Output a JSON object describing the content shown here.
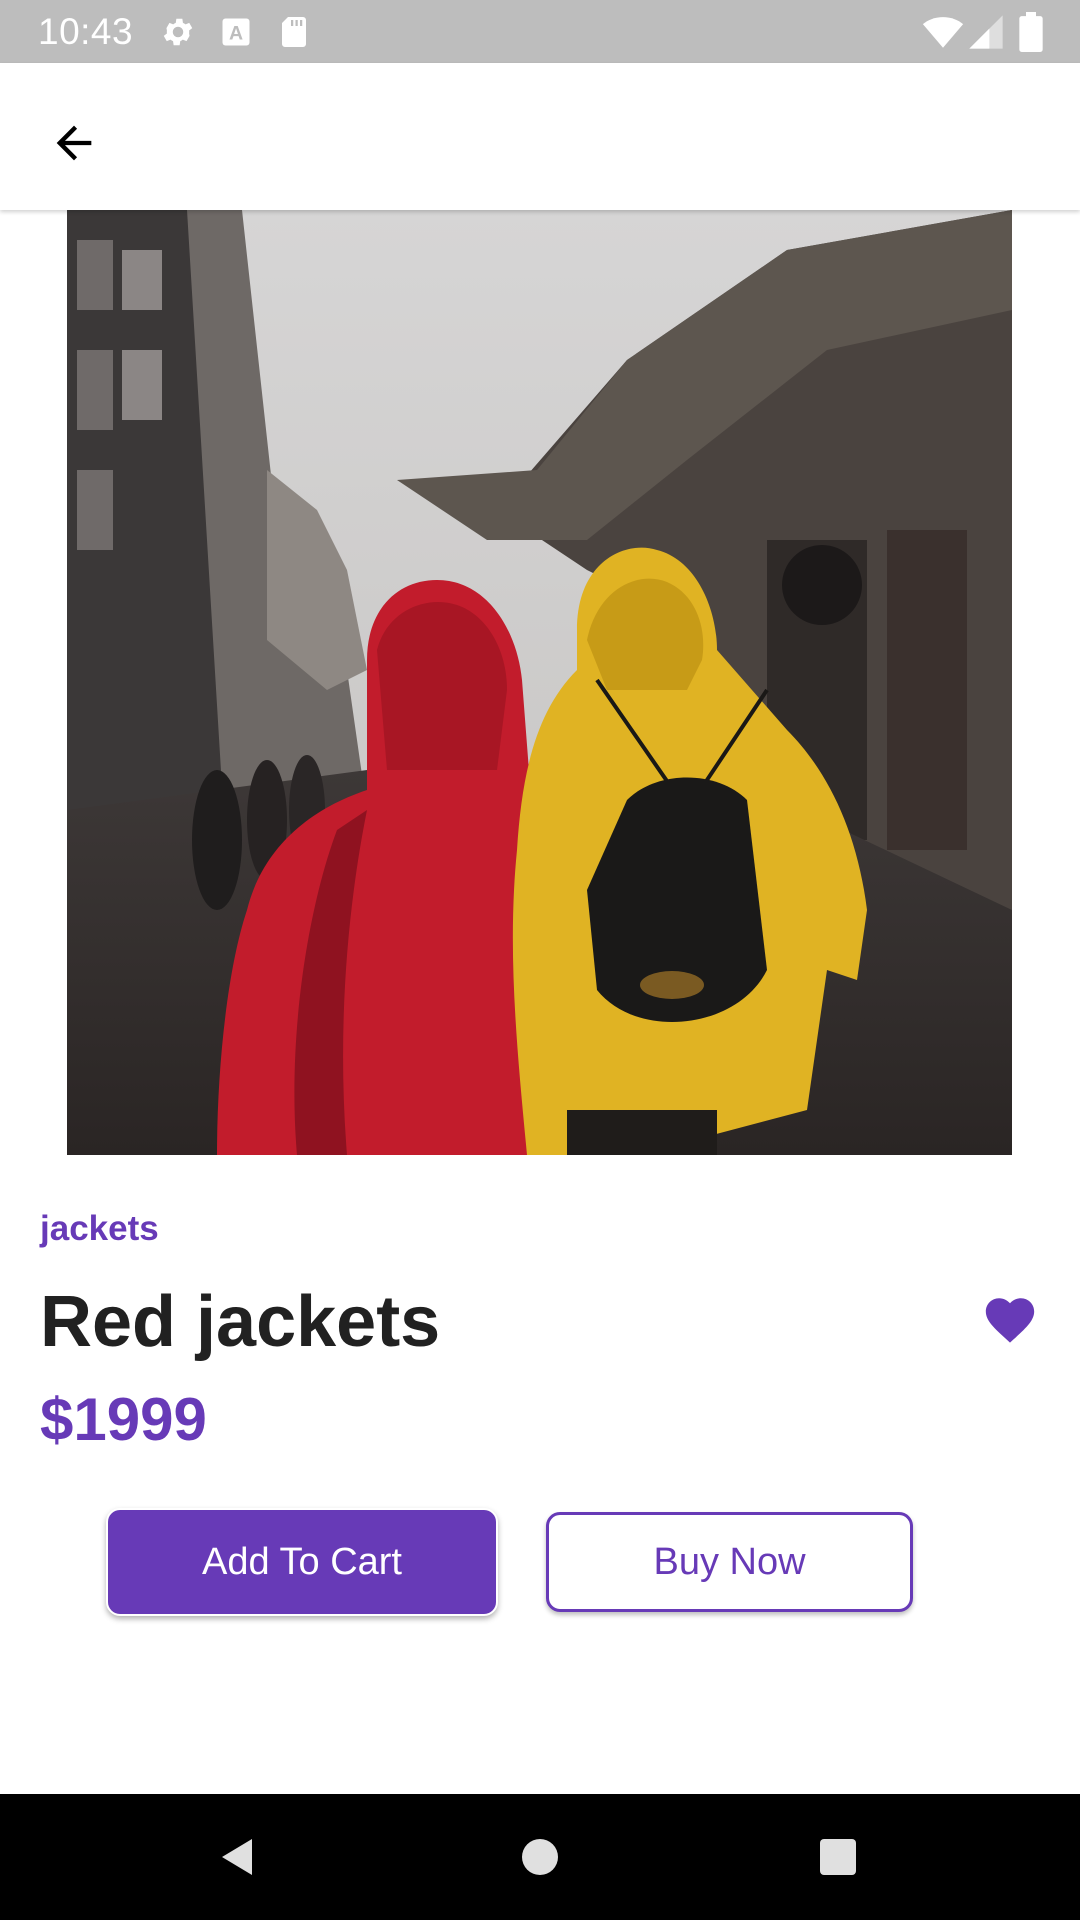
{
  "status_bar": {
    "time": "10:43",
    "left_icons": [
      "gear-icon",
      "a-box-icon",
      "sd-card-icon"
    ],
    "right_icons": [
      "wifi-icon",
      "signal-icon",
      "battery-icon"
    ]
  },
  "app_bar": {
    "back_icon": "arrow-back-icon"
  },
  "product": {
    "image": "photo of two people in red and yellow rain jackets on a city street",
    "category": "jackets",
    "title": "Red jackets",
    "price": "$1999",
    "favorite_icon": "heart-icon",
    "favorited": true
  },
  "actions": {
    "add_to_cart": "Add To Cart",
    "buy_now": "Buy Now"
  },
  "nav_bar": {
    "icons": [
      "back-triangle-icon",
      "home-circle-icon",
      "recents-square-icon"
    ]
  },
  "colors": {
    "accent": "#673ab7",
    "status_bar": "#bdbdbd",
    "nav_bar": "#000000",
    "text_dark": "#212121"
  }
}
